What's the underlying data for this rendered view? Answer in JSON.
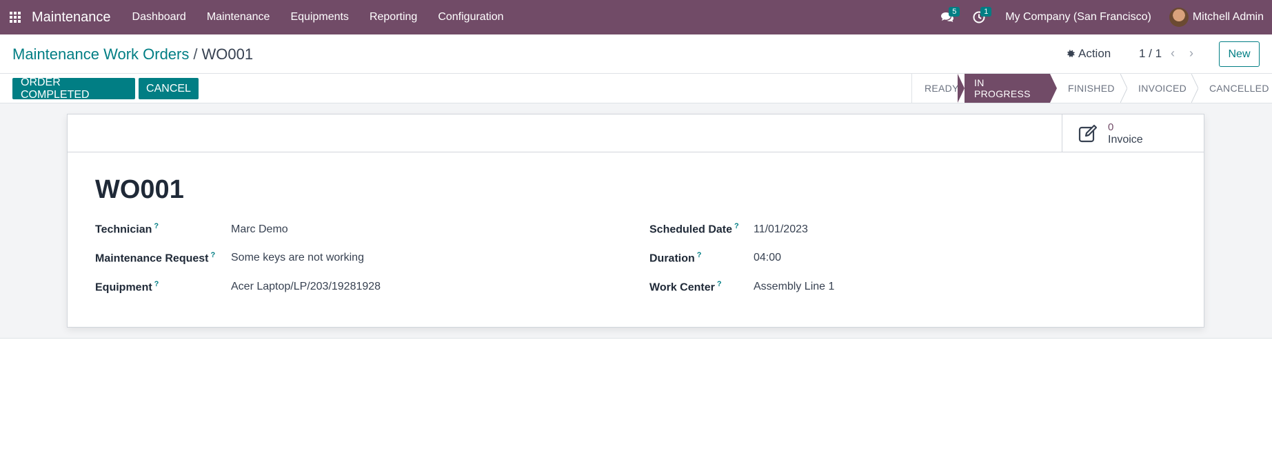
{
  "navbar": {
    "app_name": "Maintenance",
    "menu": [
      "Dashboard",
      "Maintenance",
      "Equipments",
      "Reporting",
      "Configuration"
    ],
    "messages_count": "5",
    "activities_count": "1",
    "company": "My Company (San Francisco)",
    "user": "Mitchell Admin",
    "color": "#714B67"
  },
  "control_panel": {
    "breadcrumb_parent": "Maintenance Work Orders",
    "breadcrumb_sep": "/",
    "breadcrumb_current": "WO001",
    "action_label": "Action",
    "pager": "1 / 1",
    "new_label": "New"
  },
  "statusbar": {
    "buttons": [
      "ORDER COMPLETED",
      "CANCEL"
    ],
    "stages": [
      "READY",
      "IN PROGRESS",
      "FINISHED",
      "INVOICED",
      "CANCELLED"
    ],
    "active_stage": "IN PROGRESS",
    "accent": "#017E84"
  },
  "form": {
    "smart_button": {
      "value": "0",
      "label": "Invoice",
      "icon": "edit-icon"
    },
    "title": "WO001",
    "help_mark": "?",
    "left_fields": [
      {
        "label": "Technician",
        "value": "Marc Demo"
      },
      {
        "label": "Maintenance Request",
        "value": "Some keys are not working"
      },
      {
        "label": "Equipment",
        "value": "Acer Laptop/LP/203/19281928"
      }
    ],
    "right_fields": [
      {
        "label": "Scheduled Date",
        "value": "11/01/2023"
      },
      {
        "label": "Duration",
        "value": "04:00"
      },
      {
        "label": "Work Center",
        "value": "Assembly Line 1"
      }
    ]
  }
}
